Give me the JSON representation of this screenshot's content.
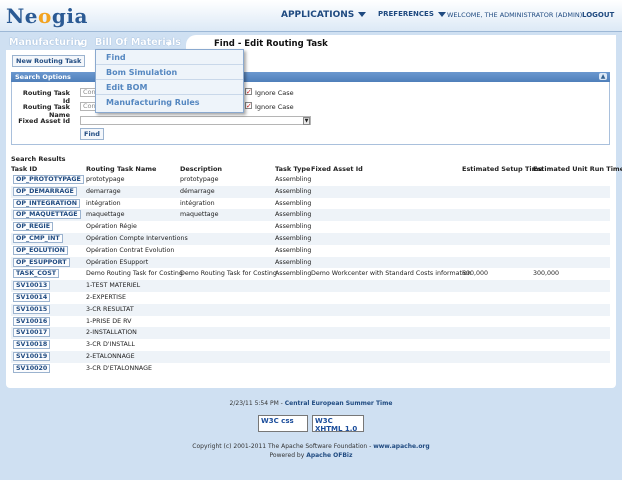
{
  "header": {
    "logo_prefix": "Ne",
    "logo_o": "o",
    "logo_suffix": "gia",
    "applications_label": "APPLICATIONS",
    "preferences_label": "PREFERENCES",
    "welcome_text": "WELCOME, THE ADMINISTRATOR (ADMIN)",
    "logout_label": "LOGOUT"
  },
  "nav": {
    "breadcrumb": [
      "Manufacturing",
      "Bill Of Materials"
    ],
    "page_title": "Find - Edit Routing Task"
  },
  "menu": {
    "items": [
      "Find",
      "Bom Simulation",
      "Edit BOM",
      "Manufacturing Rules"
    ]
  },
  "actions": {
    "new_button": "New Routing Task"
  },
  "search": {
    "section_title": "Search Options",
    "routing_task_id_label": "Routing Task Id",
    "routing_task_id_value": "Con",
    "routing_task_name_label": "Routing Task Name",
    "routing_task_name_value": "Con",
    "fixed_asset_label": "Fixed Asset Id",
    "fixed_asset_value": "",
    "ignore_case_label": "Ignore Case",
    "find_button": "Find"
  },
  "results": {
    "title": "Search Results",
    "columns": [
      "Task ID",
      "Routing Task Name",
      "Description",
      "Task Type",
      "Fixed Asset Id",
      "Estimated Setup Time",
      "Estimated Unit Run Time"
    ],
    "rows": [
      [
        "OP_PROTOTYPAGE",
        "prototypage",
        "prototypage",
        "Assembling",
        "",
        "",
        ""
      ],
      [
        "OP_DEMARRAGE",
        "demarrage",
        "démarrage",
        "Assembling",
        "",
        "",
        ""
      ],
      [
        "OP_INTEGRATION",
        "intégration",
        "intégration",
        "Assembling",
        "",
        "",
        ""
      ],
      [
        "OP_MAQUETTAGE",
        "maquettage",
        "maquettage",
        "Assembling",
        "",
        "",
        ""
      ],
      [
        "OP_REGIE",
        "Opération Régie",
        "",
        "Assembling",
        "",
        "",
        ""
      ],
      [
        "OP_CMP_INT",
        "Opération Compte Interventions",
        "",
        "Assembling",
        "",
        "",
        ""
      ],
      [
        "OP_EOLUTION",
        "Opération Contrat Evolution",
        "",
        "Assembling",
        "",
        "",
        ""
      ],
      [
        "OP_ESUPPORT",
        "Opération ESupport",
        "",
        "Assembling",
        "",
        "",
        ""
      ],
      [
        "TASK_COST",
        "Demo Routing Task for Costing",
        "Demo Routing Task for Costing",
        "Assembling",
        "Demo Workcenter with Standard Costs information",
        "600,000",
        "300,000"
      ],
      [
        "SV10013",
        "1-TEST MATERIEL",
        "",
        "",
        "",
        "",
        ""
      ],
      [
        "SV10014",
        "2-EXPERTISE",
        "",
        "",
        "",
        "",
        ""
      ],
      [
        "SV10015",
        "3-CR RESULTAT",
        "",
        "",
        "",
        "",
        ""
      ],
      [
        "SV10016",
        "1-PRISE DE RV",
        "",
        "",
        "",
        "",
        ""
      ],
      [
        "SV10017",
        "2-INSTALLATION",
        "",
        "",
        "",
        "",
        ""
      ],
      [
        "SV10018",
        "3-CR D'INSTALL",
        "",
        "",
        "",
        "",
        ""
      ],
      [
        "SV10019",
        "2-ETALONNAGE",
        "",
        "",
        "",
        "",
        ""
      ],
      [
        "SV10020",
        "3-CR D'ETALONNAGE",
        "",
        "",
        "",
        "",
        ""
      ]
    ]
  },
  "footer": {
    "datetime": "2/23/11 5:54 PM - ",
    "timezone": "Central European Summer Time",
    "badge_css": "W3C css",
    "badge_xhtml": "W3C XHTML 1.0",
    "copyright": "Copyright (c) 2001-2011 The Apache Software Foundation - ",
    "apache_link": "www.apache.org",
    "powered_by": "Powered by ",
    "ofbiz_link": "Apache OFBiz"
  },
  "colors": {
    "background": "#cfe0f2",
    "accent": "#1f4a80",
    "section_bar": "#5a88c4"
  }
}
